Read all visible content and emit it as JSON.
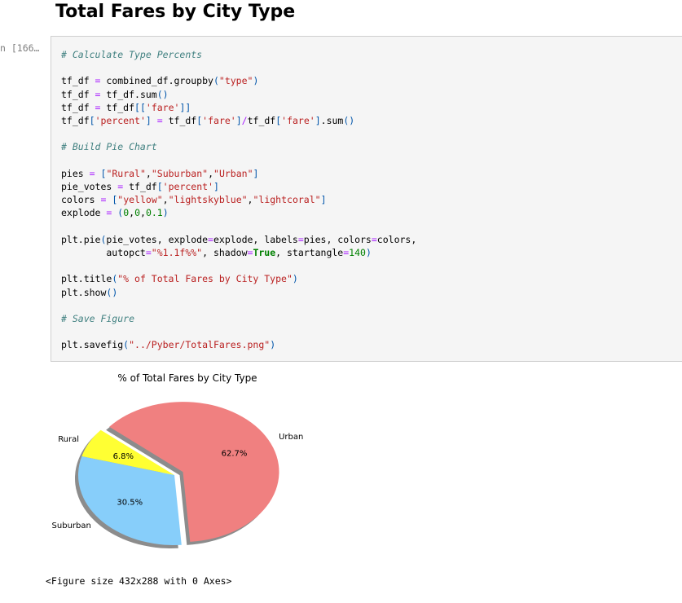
{
  "page": {
    "heading": "Total Fares by City Type"
  },
  "cell": {
    "prompt": "n [166…",
    "code": {
      "comment_calc": "# Calculate Type Percents",
      "comment_build": "# Build Pie Chart",
      "comment_save": "# Save Figure"
    }
  },
  "chart_data": {
    "type": "pie",
    "title": "% of Total Fares by City Type",
    "labels": [
      "Rural",
      "Suburban",
      "Urban"
    ],
    "values": [
      6.8,
      30.5,
      62.7
    ],
    "pct_labels": [
      "6.8%",
      "30.5%",
      "62.7%"
    ],
    "colors": [
      "#ffff33",
      "#87cefa",
      "#f08080"
    ],
    "explode": [
      0,
      0,
      0.1
    ],
    "startangle": 140,
    "shadow": true
  },
  "output": {
    "text": "<Figure size 432x288 with 0 Axes>"
  }
}
